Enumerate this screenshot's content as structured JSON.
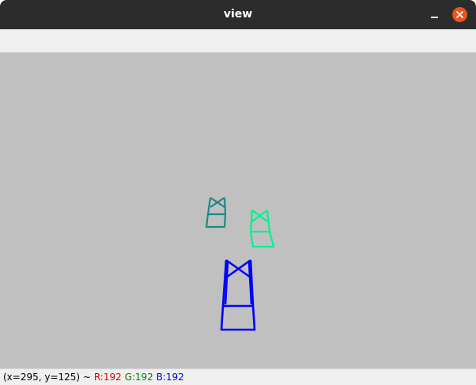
{
  "window": {
    "title": "view"
  },
  "colors": {
    "titlebar": "#2c2c2c",
    "close_button": "#e95420",
    "canvas": "#c0c0c0",
    "red_text": "#e00000",
    "green_text": "#008000",
    "blue_text": "#0000e0",
    "shape_teal": "#1a8a8a",
    "shape_green": "#00f090",
    "shape_blue": "#0000ff"
  },
  "icons": {
    "minimize": "minimize-icon",
    "close": "close-icon"
  },
  "status": {
    "coords": "(x=295, y=125) ~",
    "r": "R:192",
    "g": "G:192",
    "b": "B:192"
  }
}
